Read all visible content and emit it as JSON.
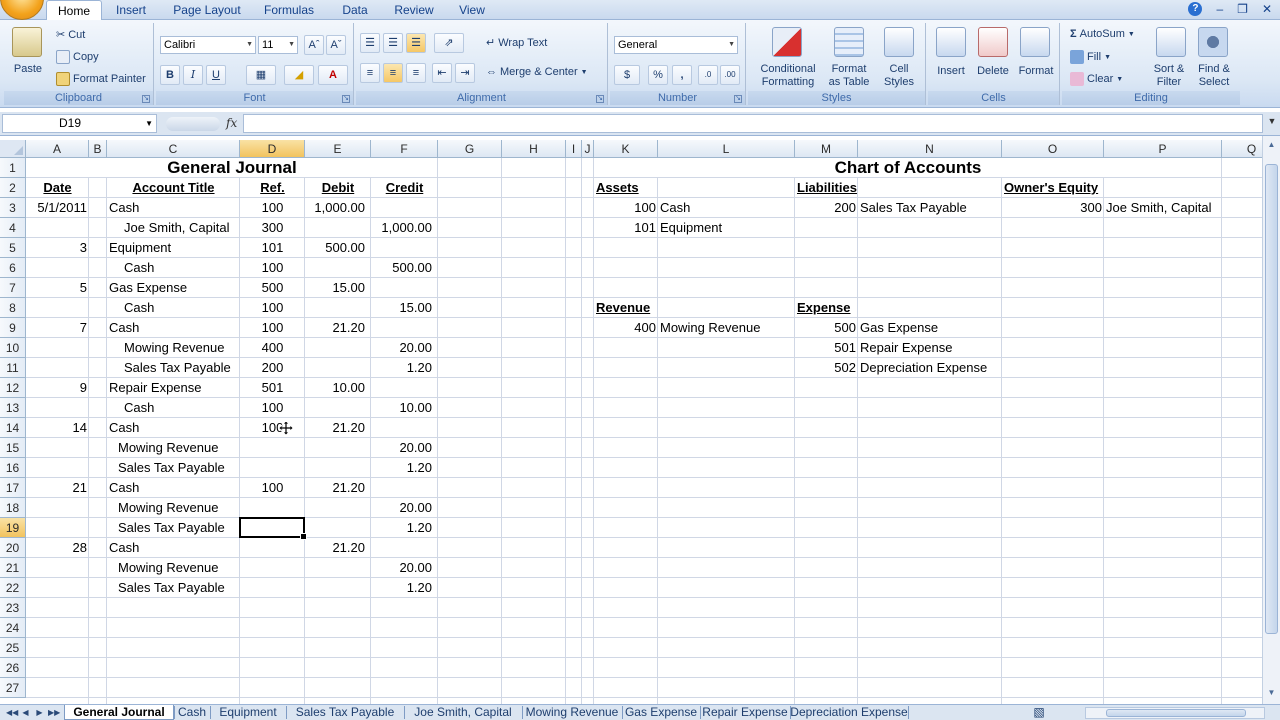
{
  "ribbon_tabs": [
    "Home",
    "Insert",
    "Page Layout",
    "Formulas",
    "Data",
    "Review",
    "View"
  ],
  "active_tab": "Home",
  "clipboard": {
    "paste": "Paste",
    "cut": "Cut",
    "copy": "Copy",
    "format_painter": "Format Painter",
    "label": "Clipboard"
  },
  "font": {
    "name": "Calibri",
    "size": "11",
    "bold": "B",
    "italic": "I",
    "underline": "U",
    "label": "Font"
  },
  "alignment": {
    "wrap_text": "Wrap Text",
    "merge_center": "Merge & Center",
    "label": "Alignment"
  },
  "number": {
    "format": "General",
    "currency": "$",
    "percent": "%",
    "comma": ",",
    "label": "Number"
  },
  "styles": {
    "conditional": "Conditional Formatting",
    "format_table": "Format as Table",
    "cell_styles": "Cell Styles",
    "label": "Styles",
    "conditional_l1": "Conditional",
    "conditional_l2": "Formatting",
    "format_table_l1": "Format",
    "format_table_l2": "as Table",
    "cell_styles_l1": "Cell",
    "cell_styles_l2": "Styles"
  },
  "cells": {
    "insert": "Insert",
    "delete": "Delete",
    "format": "Format",
    "label": "Cells"
  },
  "editing": {
    "autosum": "AutoSum",
    "fill": "Fill",
    "clear": "Clear",
    "sort_filter_l1": "Sort &",
    "sort_filter_l2": "Filter",
    "find_select_l1": "Find &",
    "find_select_l2": "Select",
    "label": "Editing"
  },
  "formula_bar": {
    "name_box": "D19",
    "fx": "fx",
    "value": ""
  },
  "columns": [
    "A",
    "B",
    "C",
    "D",
    "E",
    "F",
    "G",
    "H",
    "I",
    "J",
    "K",
    "L",
    "M",
    "N",
    "O",
    "P",
    "Q"
  ],
  "selected_column": "D",
  "rows": [
    "1",
    "2",
    "3",
    "4",
    "5",
    "6",
    "7",
    "8",
    "9",
    "10",
    "11",
    "12",
    "13",
    "14",
    "15",
    "16",
    "17",
    "18",
    "19",
    "20",
    "21",
    "22",
    "23",
    "24",
    "25",
    "26",
    "27"
  ],
  "selected_row": "19",
  "journal": {
    "title": "General Journal",
    "headers": {
      "date": "Date",
      "account": "Account Title",
      "ref": "Ref.",
      "debit": "Debit",
      "credit": "Credit"
    },
    "entries": [
      {
        "row": 3,
        "date": "5/1/2011",
        "account": "Cash",
        "indent": 0,
        "ref": "100",
        "debit": "1,000.00",
        "credit": ""
      },
      {
        "row": 4,
        "date": "",
        "account": "Joe Smith, Capital",
        "indent": 1,
        "ref": "300",
        "debit": "",
        "credit": "1,000.00"
      },
      {
        "row": 5,
        "date": "3",
        "account": "Equipment",
        "indent": 0,
        "ref": "101",
        "debit": "500.00",
        "credit": ""
      },
      {
        "row": 6,
        "date": "",
        "account": "Cash",
        "indent": 1,
        "ref": "100",
        "debit": "",
        "credit": "500.00"
      },
      {
        "row": 7,
        "date": "5",
        "account": "Gas Expense",
        "indent": 0,
        "ref": "500",
        "debit": "15.00",
        "credit": ""
      },
      {
        "row": 8,
        "date": "",
        "account": "Cash",
        "indent": 1,
        "ref": "100",
        "debit": "",
        "credit": "15.00"
      },
      {
        "row": 9,
        "date": "7",
        "account": "Cash",
        "indent": 0,
        "ref": "100",
        "debit": "21.20",
        "credit": ""
      },
      {
        "row": 10,
        "date": "",
        "account": "Mowing Revenue",
        "indent": 1,
        "ref": "400",
        "debit": "",
        "credit": "20.00"
      },
      {
        "row": 11,
        "date": "",
        "account": "Sales Tax Payable",
        "indent": 1,
        "ref": "200",
        "debit": "",
        "credit": "1.20"
      },
      {
        "row": 12,
        "date": "9",
        "account": "Repair Expense",
        "indent": 0,
        "ref": "501",
        "debit": "10.00",
        "credit": ""
      },
      {
        "row": 13,
        "date": "",
        "account": "Cash",
        "indent": 1,
        "ref": "100",
        "debit": "",
        "credit": "10.00"
      },
      {
        "row": 14,
        "date": "14",
        "account": "Cash",
        "indent": 0,
        "ref": "100",
        "debit": "21.20",
        "credit": ""
      },
      {
        "row": 15,
        "date": "",
        "account": "Mowing Revenue",
        "indent": 2,
        "ref": "",
        "debit": "",
        "credit": "20.00"
      },
      {
        "row": 16,
        "date": "",
        "account": "Sales Tax Payable",
        "indent": 2,
        "ref": "",
        "debit": "",
        "credit": "1.20"
      },
      {
        "row": 17,
        "date": "21",
        "account": "Cash",
        "indent": 0,
        "ref": "100",
        "debit": "21.20",
        "credit": ""
      },
      {
        "row": 18,
        "date": "",
        "account": "Mowing Revenue",
        "indent": 2,
        "ref": "",
        "debit": "",
        "credit": "20.00"
      },
      {
        "row": 19,
        "date": "",
        "account": "Sales Tax Payable",
        "indent": 2,
        "ref": "",
        "debit": "",
        "credit": "1.20"
      },
      {
        "row": 20,
        "date": "28",
        "account": "Cash",
        "indent": 0,
        "ref": "",
        "debit": "21.20",
        "credit": ""
      },
      {
        "row": 21,
        "date": "",
        "account": "Mowing Revenue",
        "indent": 2,
        "ref": "",
        "debit": "",
        "credit": "20.00"
      },
      {
        "row": 22,
        "date": "",
        "account": "Sales Tax Payable",
        "indent": 2,
        "ref": "",
        "debit": "",
        "credit": "1.20"
      }
    ]
  },
  "chart_of_accounts": {
    "title": "Chart of Accounts",
    "assets": {
      "heading": "Assets",
      "items": [
        {
          "num": "100",
          "name": "Cash"
        },
        {
          "num": "101",
          "name": "Equipment"
        }
      ]
    },
    "liabilities": {
      "heading": "Liabilities",
      "items": [
        {
          "num": "200",
          "name": "Sales Tax Payable"
        }
      ]
    },
    "equity": {
      "heading": "Owner's Equity",
      "items": [
        {
          "num": "300",
          "name": "Joe Smith, Capital"
        }
      ]
    },
    "revenue": {
      "heading": "Revenue",
      "items": [
        {
          "num": "400",
          "name": "Mowing Revenue"
        }
      ]
    },
    "expense": {
      "heading": "Expense",
      "items": [
        {
          "num": "500",
          "name": "Gas Expense"
        },
        {
          "num": "501",
          "name": "Repair Expense"
        },
        {
          "num": "502",
          "name": "Depreciation Expense"
        }
      ]
    }
  },
  "sheet_tabs": [
    "General Journal",
    "Cash",
    "Equipment",
    "Sales Tax Payable",
    "Joe Smith, Capital",
    "Mowing Revenue",
    "Gas Expense",
    "Repair Expense",
    "Depreciation Expense"
  ],
  "active_sheet": "General Journal",
  "colors": {
    "accent": "#15428b",
    "selected_header": "#f2c35e",
    "gridline": "#d0d7e5"
  }
}
